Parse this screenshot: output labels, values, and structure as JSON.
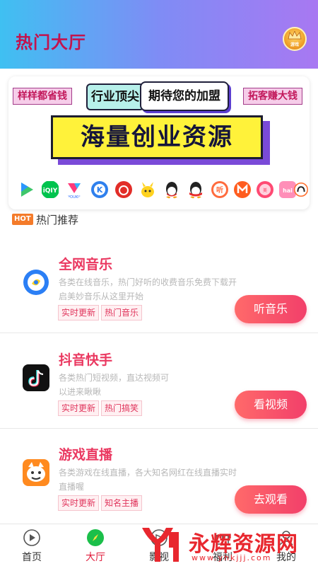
{
  "header": {
    "title": "热门大厅",
    "avatar_label": "游戏"
  },
  "banner": {
    "tag_left": "样样都省钱",
    "tag_right": "拓客赚大钱",
    "pill1": "行业顶尖",
    "pill2": "期待您的加盟",
    "headline": "海量创业资源",
    "logos": [
      "iqiyi-icon",
      "youku-icon",
      "kuwo-icon",
      "netease-music-icon",
      "bilibili-icon",
      "qq-icon",
      "qq-music-icon",
      "ting-icon",
      "mgtv-icon",
      "meiyan-icon",
      "haixiu-icon",
      "mm-icon"
    ]
  },
  "hot": {
    "badge": "HOT",
    "title": "热门推荐"
  },
  "cards": [
    {
      "name": "全网音乐",
      "desc": "各类在线音乐，热门好听的收费音乐免费下载开启美妙音乐从这里开始",
      "chips": [
        "实时更新",
        "热门音乐"
      ],
      "action": "听音乐",
      "icon": "music-icon"
    },
    {
      "name": "抖音快手",
      "desc": "各类热门短视频，直达视频可以进来瞅瞅",
      "chips": [
        "实时更新",
        "热门搞笑"
      ],
      "action": "看视频",
      "icon": "douyin-icon"
    },
    {
      "name": "游戏直播",
      "desc": "各类游戏在线直播，各大知名网红在线直播实时直播喔",
      "chips": [
        "实时更新",
        "知名主播"
      ],
      "action": "去观看",
      "icon": "game-live-icon"
    }
  ],
  "nav": {
    "items": [
      {
        "label": "首页"
      },
      {
        "label": "大厅"
      },
      {
        "label": "影视"
      },
      {
        "label": "福利"
      },
      {
        "label": "我的"
      }
    ],
    "active_index": 1
  },
  "watermark": {
    "text": "永辉资源网",
    "sub": "www.yhkjjj.com"
  },
  "colors": {
    "accent": "#e01e3d",
    "card_title": "#ea3860",
    "header_start": "#3fc0f2",
    "header_end": "#a878f2"
  }
}
